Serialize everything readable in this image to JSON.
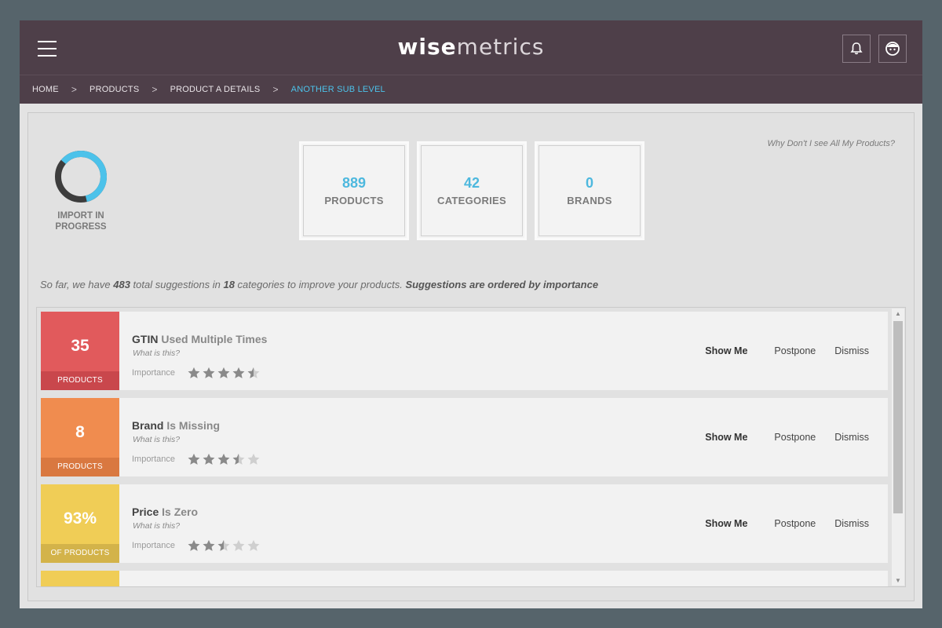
{
  "header": {
    "logo_part1": "wise",
    "logo_part2": "metrics",
    "menu_icon": "hamburger-icon",
    "notifications_icon": "bell-icon",
    "profile_icon": "user-face-icon"
  },
  "breadcrumb": {
    "items": [
      "HOME",
      "PRODUCTS",
      "PRODUCT A DETAILS",
      "ANOTHER SUB LEVEL"
    ],
    "separator": ">",
    "active_color": "#4cc2ea"
  },
  "import": {
    "label_line1": "IMPORT IN",
    "label_line2": "PROGRESS",
    "progress": 0.6
  },
  "stats": [
    {
      "value": "889",
      "label": "PRODUCTS"
    },
    {
      "value": "42",
      "label": "CATEGORIES"
    },
    {
      "value": "0",
      "label": "BRANDS"
    }
  ],
  "why_link": "Why Don't I see All My Products?",
  "summary": {
    "t1": "So far, we have ",
    "total": "483",
    "t2": " total suggestions in ",
    "categories": "18",
    "t3": " categories to improve your products. ",
    "emphasis": "Suggestions are ordered by importance"
  },
  "suggestions": [
    {
      "badge_value": "35",
      "badge_label": "PRODUCTS",
      "title_bold": "GTIN",
      "title_rest": " Used Multiple Times",
      "what": "What is this?",
      "importance_label": "Importance",
      "importance": 4.5,
      "color": "#e15a5c",
      "color_dark": "#c9474c",
      "actions": {
        "show": "Show Me",
        "postpone": "Postpone",
        "dismiss": "Dismiss"
      }
    },
    {
      "badge_value": "8",
      "badge_label": "PRODUCTS",
      "title_bold": "Brand",
      "title_rest": " Is Missing",
      "what": "What is this?",
      "importance_label": "Importance",
      "importance": 3.5,
      "color": "#f08c4f",
      "color_dark": "#d97840",
      "actions": {
        "show": "Show Me",
        "postpone": "Postpone",
        "dismiss": "Dismiss"
      }
    },
    {
      "badge_value": "93%",
      "badge_label": "OF PRODUCTS",
      "title_bold": "Price",
      "title_rest": " Is Zero",
      "what": "What is this?",
      "importance_label": "Importance",
      "importance": 2.5,
      "color": "#f0cd56",
      "color_dark": "#d3b34a",
      "actions": {
        "show": "Show Me",
        "postpone": "Postpone",
        "dismiss": "Dismiss"
      }
    },
    {
      "color": "#f0cd56"
    }
  ]
}
